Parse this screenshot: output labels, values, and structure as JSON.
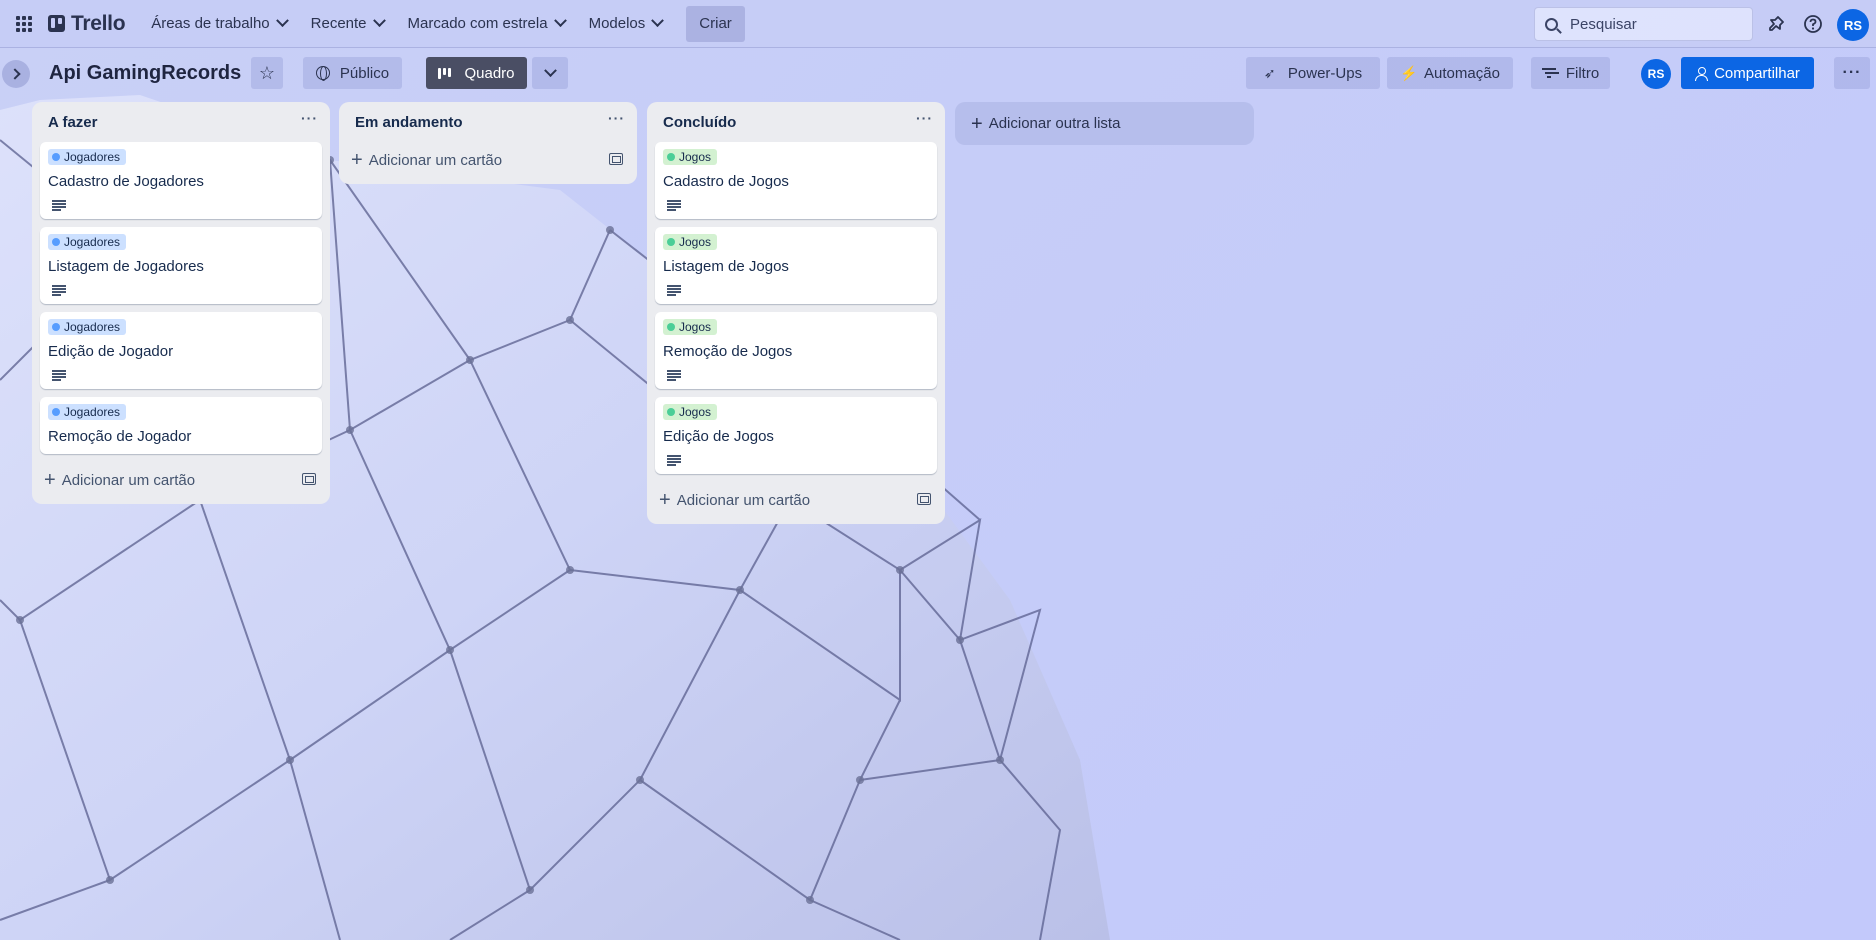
{
  "nav": {
    "logo_text": "Trello",
    "menus": [
      {
        "label": "Áreas de trabalho"
      },
      {
        "label": "Recente"
      },
      {
        "label": "Marcado com estrela"
      },
      {
        "label": "Modelos"
      }
    ],
    "create_label": "Criar",
    "search_placeholder": "Pesquisar",
    "avatar_initials": "RS",
    "icons": [
      "apps-grid-icon",
      "notifications-icon",
      "help-icon"
    ]
  },
  "board": {
    "title": "Api GamingRecords",
    "visibility_label": "Público",
    "view_label": "Quadro",
    "powerups_label": "Power-Ups",
    "automation_label": "Automação",
    "filter_label": "Filtro",
    "member_initials": "RS",
    "share_label": "Compartilhar",
    "add_list_label": "Adicionar outra lista"
  },
  "lists": [
    {
      "title": "A fazer",
      "cards": [
        {
          "label": "Jogadores",
          "label_color": "blue",
          "title": "Cadastro de Jogadores",
          "has_description": true
        },
        {
          "label": "Jogadores",
          "label_color": "blue",
          "title": "Listagem de Jogadores",
          "has_description": true
        },
        {
          "label": "Jogadores",
          "label_color": "blue",
          "title": "Edição de Jogador",
          "has_description": true
        },
        {
          "label": "Jogadores",
          "label_color": "blue",
          "title": "Remoção de Jogador",
          "has_description": false
        }
      ],
      "add_card_label": "Adicionar um cartão"
    },
    {
      "title": "Em andamento",
      "cards": [],
      "add_card_label": "Adicionar um cartão"
    },
    {
      "title": "Concluído",
      "cards": [
        {
          "label": "Jogos",
          "label_color": "green",
          "title": "Cadastro de Jogos",
          "has_description": true
        },
        {
          "label": "Jogos",
          "label_color": "green",
          "title": "Listagem de Jogos",
          "has_description": true
        },
        {
          "label": "Jogos",
          "label_color": "green",
          "title": "Remoção de Jogos",
          "has_description": true
        },
        {
          "label": "Jogos",
          "label_color": "green",
          "title": "Edição de Jogos",
          "has_description": true
        }
      ],
      "add_card_label": "Adicionar um cartão"
    }
  ],
  "colors": {
    "accent": "#0c66e4",
    "label_blue": "#cce0ff",
    "label_green": "#d3f1d1",
    "list_bg": "#ebecf0"
  }
}
